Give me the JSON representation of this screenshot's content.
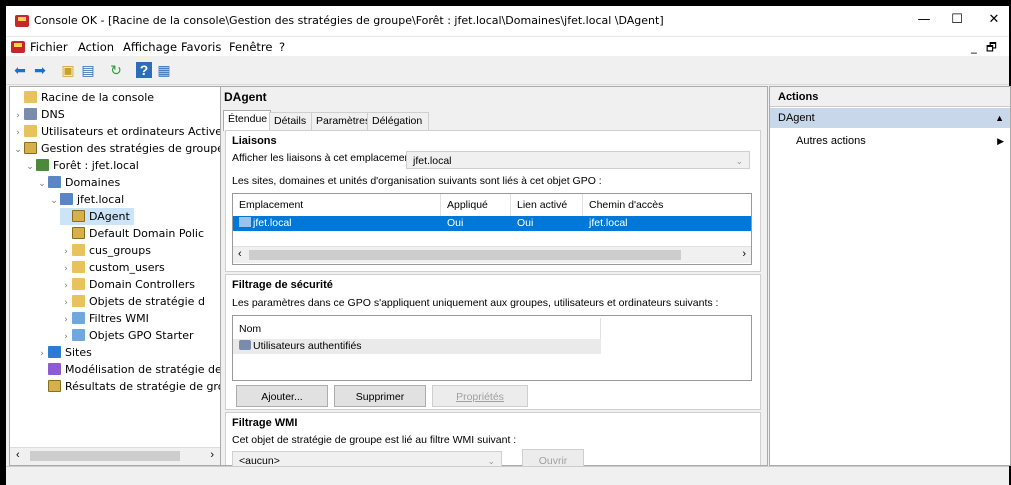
{
  "window": {
    "title": "Console OK - [Racine de la console\\Gestion des stratégies de groupe\\Forêt : jfet.local\\Domaines\\jfet.local \\DAgent]",
    "minimize": "—",
    "maximize": "☐",
    "close": "✕"
  },
  "menu": {
    "items": [
      "Fichier",
      "Action",
      "Affichage",
      "Favoris",
      "Fenêtre",
      "?"
    ],
    "doc_minimize": "_",
    "doc_restore": "🗗"
  },
  "toolbar": {
    "icons": [
      "back-arrow-icon",
      "forward-arrow-icon",
      "up-folder-icon",
      "show-hide-tree-icon",
      "refresh-icon",
      "help-icon",
      "properties-icon"
    ]
  },
  "tree": {
    "items": [
      {
        "label": "Racine de la console",
        "toggle": "",
        "icon": "folder"
      },
      {
        "label": "DNS",
        "toggle": "›",
        "icon": "person"
      },
      {
        "label": "Utilisateurs et ordinateurs Active Dir",
        "toggle": "›",
        "icon": "folder"
      },
      {
        "label": "Gestion des stratégies de groupe",
        "toggle": "⌄",
        "icon": "gpo"
      },
      {
        "label": "Forêt : jfet.local",
        "toggle": "⌄",
        "icon": "forest"
      },
      {
        "label": "Domaines",
        "toggle": "⌄",
        "icon": "domain"
      },
      {
        "label": "jfet.local",
        "toggle": "⌄",
        "icon": "domain"
      },
      {
        "label": "DAgent",
        "toggle": "",
        "icon": "gpo"
      },
      {
        "label": "Default Domain Polic",
        "toggle": "",
        "icon": "gpo"
      },
      {
        "label": "cus_groups",
        "toggle": "›",
        "icon": "folder"
      },
      {
        "label": "custom_users",
        "toggle": "›",
        "icon": "folder"
      },
      {
        "label": "Domain Controllers",
        "toggle": "›",
        "icon": "folder"
      },
      {
        "label": "Objets de stratégie d",
        "toggle": "›",
        "icon": "folder"
      },
      {
        "label": "Filtres WMI",
        "toggle": "›",
        "icon": "wmi"
      },
      {
        "label": "Objets GPO Starter",
        "toggle": "›",
        "icon": "wmi"
      },
      {
        "label": "Sites",
        "toggle": "›",
        "icon": "sites"
      },
      {
        "label": "Modélisation de stratégie de",
        "toggle": "",
        "icon": "model"
      },
      {
        "label": "Résultats de stratégie de gro",
        "toggle": "",
        "icon": "gpo"
      }
    ],
    "selected": "DAgent",
    "scroll_left": "‹",
    "scroll_right": "›"
  },
  "main": {
    "title": "DAgent",
    "tabs": [
      "Étendue",
      "Détails",
      "Paramètres",
      "Délégation"
    ],
    "active_tab": "Étendue",
    "liaisons": {
      "heading": "Liaisons",
      "location_label": "Afficher les liaisons à cet emplacement :",
      "location_value": "jfet.local",
      "description": "Les sites, domaines et unités d'organisation suivants sont liés à cet objet GPO :",
      "columns": [
        "Emplacement",
        "Appliqué",
        "Lien activé",
        "Chemin d'accès"
      ],
      "rows": [
        {
          "location": "jfet.local",
          "applied": "Oui",
          "enabled": "Oui",
          "path": "jfet.local"
        }
      ],
      "scroll_left": "‹",
      "scroll_right": "›"
    },
    "security": {
      "heading": "Filtrage de sécurité",
      "description": "Les paramètres dans ce GPO s'appliquent uniquement aux groupes, utilisateurs et ordinateurs suivants :",
      "column": "Nom",
      "rows": [
        "Utilisateurs authentifiés"
      ],
      "add_button": "Ajouter...",
      "remove_button": "Supprimer",
      "properties_button": "Propriétés"
    },
    "wmi": {
      "heading": "Filtrage WMI",
      "description": "Cet objet de stratégie de groupe est lié au filtre WMI suivant :",
      "value": "<aucun>",
      "open_button": "Ouvrir"
    }
  },
  "actions": {
    "heading": "Actions",
    "context": "DAgent",
    "more": "Autres actions"
  }
}
